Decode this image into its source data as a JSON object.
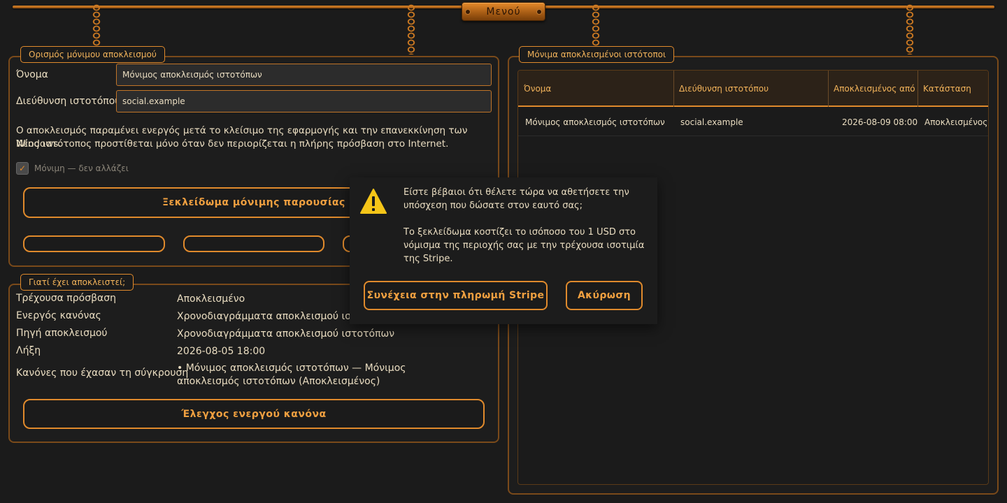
{
  "menu": {
    "label": "Μενού"
  },
  "left_panel": {
    "title": "Ορισμός μόνιμου αποκλεισμού",
    "name_label": "Όνομα",
    "name_value": "Μόνιμος αποκλεισμός ιστοτόπων",
    "site_label": "Διεύθυνση ιστοτόπου",
    "site_value": "social.example",
    "description_line1": "Ο αποκλεισμός παραμένει ενεργός μετά το κλείσιμο της εφαρμογής και την επανεκκίνηση των Windows.",
    "description_line2": "Νέος ιστότοπος προστίθεται μόνο όταν δεν περιορίζεται η πλήρης πρόσβαση στο Internet.",
    "permanent_checkbox_label": "Μόνιμη — δεν αλλάζει",
    "permanent_checked": true,
    "unlock_button": "Ξεκλείδωμα μόνιμης παρουσίας"
  },
  "why_panel": {
    "title": "Γιατί έχει αποκλειστεί;",
    "rows": [
      {
        "key": "Τρέχουσα πρόσβαση",
        "value": "Αποκλεισμένο"
      },
      {
        "key": "Ενεργός κανόνας",
        "value": "Χρονοδιαγράμματα αποκλεισμού ιστοτόπων"
      },
      {
        "key": "Πηγή αποκλεισμού",
        "value": "Χρονοδιαγράμματα αποκλεισμού ιστοτόπων"
      },
      {
        "key": "Λήξη",
        "value": "2026-08-05 18:00"
      },
      {
        "key": "Κανόνες που έχασαν τη σύγκρουση",
        "value": "• Μόνιμος αποκλεισμός ιστοτόπων — Μόνιμος αποκλεισμός ιστοτόπων (Αποκλεισμένος)"
      }
    ],
    "check_button": "Έλεγχος ενεργού κανόνα"
  },
  "right_panel": {
    "title": "Μόνιμα αποκλεισμένοι ιστότοποι",
    "columns": [
      "Όνομα",
      "Διεύθυνση ιστοτόπου",
      "Αποκλεισμένος από",
      "Κατάσταση"
    ],
    "rows": [
      [
        "Μόνιμος αποκλεισμός ιστοτόπων",
        "social.example",
        "2026-08-09 08:00",
        "Αποκλεισμένος"
      ]
    ]
  },
  "dialog": {
    "icon": "warning-icon",
    "line1": "Είστε βέβαιοι ότι θέλετε τώρα να αθετήσετε την",
    "line2": "υπόσχεση που δώσατε στον εαυτό σας;",
    "line3": "Το ξεκλείδωμα κοστίζει το ισόποσο του 1 USD στο",
    "line4": "νόμισμα της περιοχής σας με την τρέχουσα ισοτιμία",
    "line5": "της Stripe.",
    "confirm_button": "Συνέχεια στην πληρωμή Stripe",
    "cancel_button": "Ακύρωση"
  },
  "colors": {
    "accent": "#e08a2c",
    "background": "#1b1b1b",
    "text": "#e9dcc0",
    "title": "#f2b35a"
  }
}
